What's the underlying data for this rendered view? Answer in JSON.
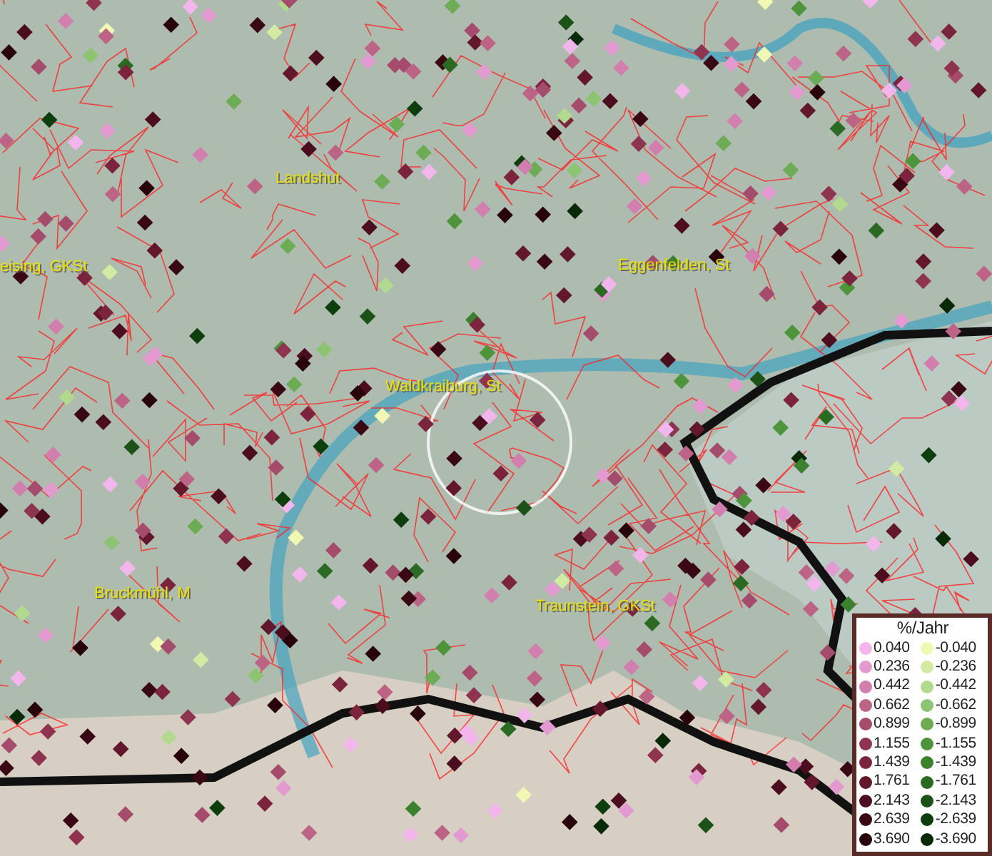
{
  "map": {
    "place_labels": [
      {
        "text": "Landshut"
      },
      {
        "text": "eising, GKSt"
      },
      {
        "text": "Eggenfelden, St"
      },
      {
        "text": "Waldkraiburg, St"
      },
      {
        "text": "Bruckmühl, M"
      },
      {
        "text": "Traunstein, GKSt"
      }
    ]
  },
  "legend": {
    "title": "%/Jahr",
    "positive": [
      {
        "value": "0.040",
        "color": "#f2b6ec"
      },
      {
        "value": "0.236",
        "color": "#e29ad0"
      },
      {
        "value": "0.442",
        "color": "#d27eae"
      },
      {
        "value": "0.662",
        "color": "#bd6486"
      },
      {
        "value": "0.899",
        "color": "#a54c6c"
      },
      {
        "value": "1.155",
        "color": "#8e3350"
      },
      {
        "value": "1.439",
        "color": "#7c243e"
      },
      {
        "value": "1.761",
        "color": "#62172c"
      },
      {
        "value": "2.143",
        "color": "#4c0d1e"
      },
      {
        "value": "2.639",
        "color": "#3a0814"
      },
      {
        "value": "3.690",
        "color": "#28040a"
      }
    ],
    "negative": [
      {
        "value": "-0.040",
        "color": "#f0f8b4"
      },
      {
        "value": "-0.236",
        "color": "#d2eaa2"
      },
      {
        "value": "-0.442",
        "color": "#b2da8e"
      },
      {
        "value": "-0.662",
        "color": "#8cc472"
      },
      {
        "value": "-0.899",
        "color": "#6cac54"
      },
      {
        "value": "-1.155",
        "color": "#4e943a"
      },
      {
        "value": "-1.439",
        "color": "#3c822e"
      },
      {
        "value": "-1.761",
        "color": "#2a6a22"
      },
      {
        "value": "-2.143",
        "color": "#1c5218"
      },
      {
        "value": "-2.639",
        "color": "#0e3e0e"
      },
      {
        "value": "-3.690",
        "color": "#082a08"
      }
    ]
  }
}
